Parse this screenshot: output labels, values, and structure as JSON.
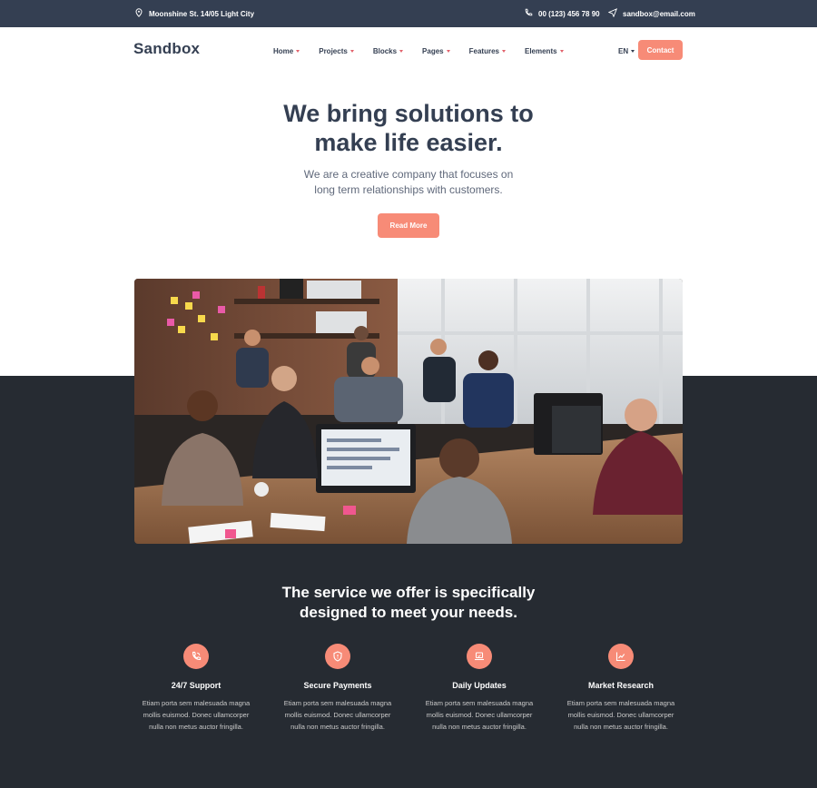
{
  "topbar": {
    "address": "Moonshine St. 14/05 Light City",
    "phone": "00 (123) 456 78 90",
    "email": "sandbox@email.com"
  },
  "nav": {
    "logo": "Sandbox",
    "items": [
      {
        "label": "Home"
      },
      {
        "label": "Projects"
      },
      {
        "label": "Blocks"
      },
      {
        "label": "Pages"
      },
      {
        "label": "Features"
      },
      {
        "label": "Elements"
      }
    ],
    "lang": "EN",
    "contact": "Contact"
  },
  "hero": {
    "title_line1": "We bring solutions to",
    "title_line2": "make life easier.",
    "sub_line1": "We are a creative company that focuses on",
    "sub_line2": "long term relationships with customers.",
    "button": "Read More"
  },
  "services": {
    "title_line1": "The service we offer is specifically",
    "title_line2": "designed to meet your needs.",
    "items": [
      {
        "icon": "phone-icon",
        "name": "24/7 Support",
        "d1": "Etiam porta sem malesuada magna",
        "d2": "mollis euismod. Donec ullamcorper",
        "d3": "nulla non metus auctor fringilla."
      },
      {
        "icon": "shield-icon",
        "name": "Secure Payments",
        "d1": "Etiam porta sem malesuada magna",
        "d2": "mollis euismod. Donec ullamcorper",
        "d3": "nulla non metus auctor fringilla."
      },
      {
        "icon": "laptop-icon",
        "name": "Daily Updates",
        "d1": "Etiam porta sem malesuada magna",
        "d2": "mollis euismod. Donec ullamcorper",
        "d3": "nulla non metus auctor fringilla."
      },
      {
        "icon": "chart-line-icon",
        "name": "Market Research",
        "d1": "Etiam porta sem malesuada magna",
        "d2": "mollis euismod. Donec ullamcorper",
        "d3": "nulla non metus auctor fringilla."
      }
    ]
  },
  "colors": {
    "accent": "#f78b77",
    "dark": "#343f52",
    "dark_section": "#262b32",
    "caret": "#e2626b"
  }
}
